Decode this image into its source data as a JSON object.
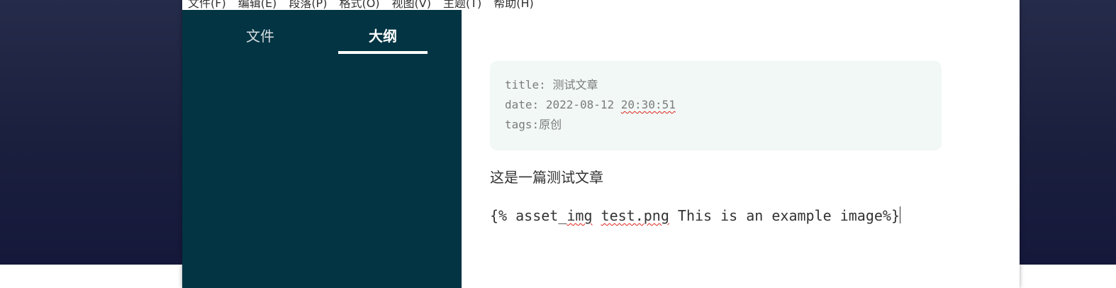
{
  "menubar": {
    "items": [
      "文件(F)",
      "编辑(E)",
      "段落(P)",
      "格式(O)",
      "视图(V)",
      "主题(T)",
      "帮助(H)"
    ]
  },
  "sidebar": {
    "tabs": [
      {
        "label": "文件",
        "active": false
      },
      {
        "label": "大纲",
        "active": true
      }
    ]
  },
  "editor": {
    "front_matter": {
      "title_key": "title:",
      "title_value": "测试文章",
      "date_key": "date:",
      "date_value": "2022-08-12",
      "time_value": "20:30:51",
      "tags_key": "tags:",
      "tags_value": "原创"
    },
    "paragraph": "这是一篇测试文章",
    "code": {
      "prefix": "{% asset_",
      "img": "img",
      "file": "test.png",
      "rest": " This is an example image%}"
    }
  },
  "colors": {
    "sidebar_bg": "#023443",
    "front_matter_bg": "#f1f8f6",
    "spellcheck_underline": "#e0241a"
  }
}
